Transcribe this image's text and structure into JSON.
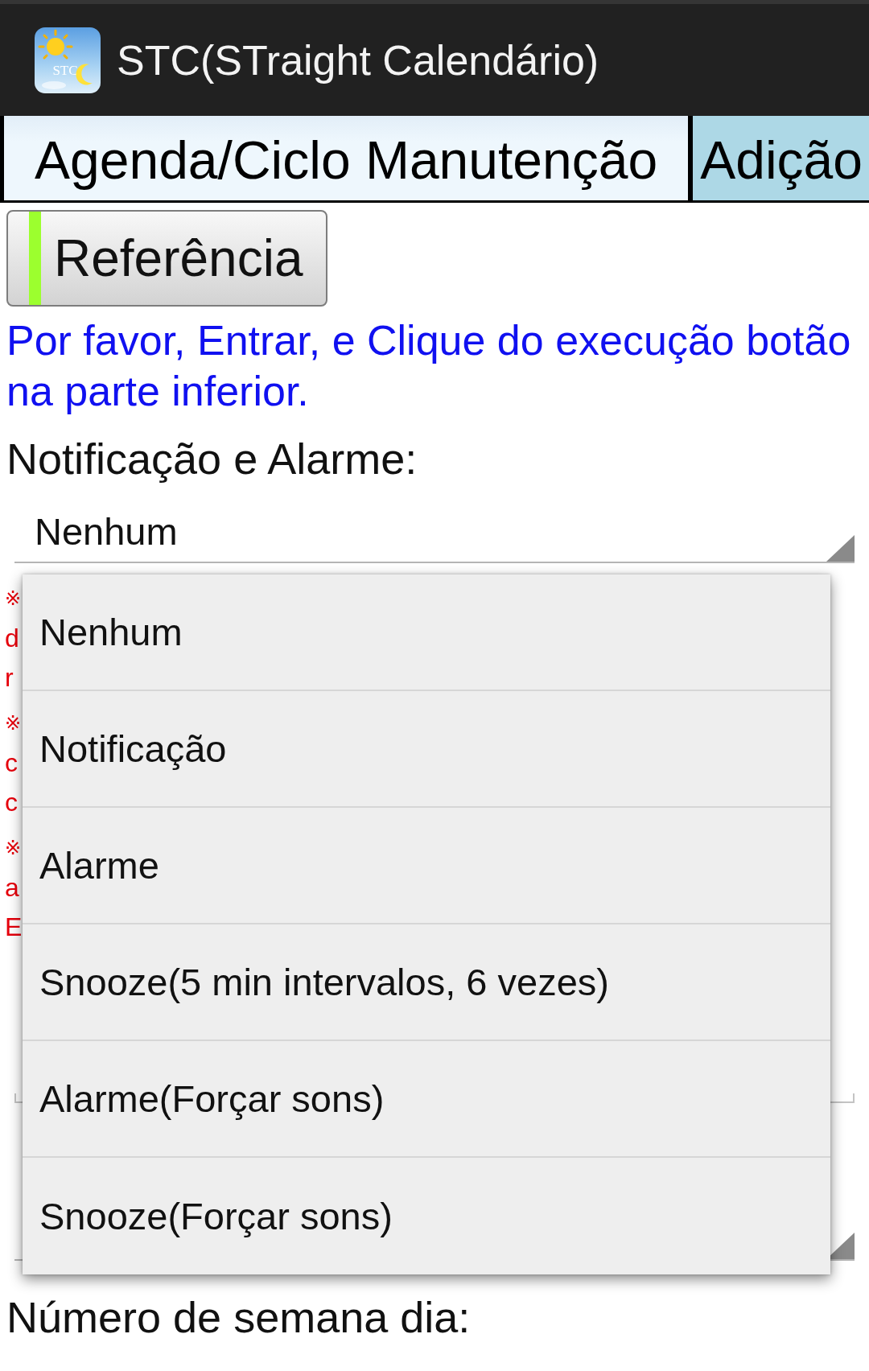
{
  "app_bar": {
    "logo_text": "STC",
    "title": "STC(STraight Calendário)"
  },
  "tabs": [
    {
      "label": "Agenda/Ciclo Manutenção",
      "selected": true
    },
    {
      "label": "Adição",
      "selected": false
    }
  ],
  "reference_button": {
    "label": "Referência",
    "on": true
  },
  "instruction": "Por favor, Entrar, e Clique do execução botão na parte inferior.",
  "notification": {
    "label": "Notificação e Alarme:",
    "value": "Nenhum"
  },
  "notes": [
    {
      "lines": [
        "※",
        "d",
        "r"
      ]
    },
    {
      "lines": [
        "※",
        "c",
        "c"
      ]
    },
    {
      "lines": [
        "※",
        "a",
        "E"
      ]
    }
  ],
  "dropdown_menu": {
    "options": [
      "Nenhum",
      "Notificação",
      "Alarme",
      "Snooze(5 min intervalos, 6 vezes)",
      "Alarme(Forçar sons)",
      "Snooze(Forçar sons)"
    ]
  },
  "week_day": {
    "label": "Número de semana dia:"
  }
}
